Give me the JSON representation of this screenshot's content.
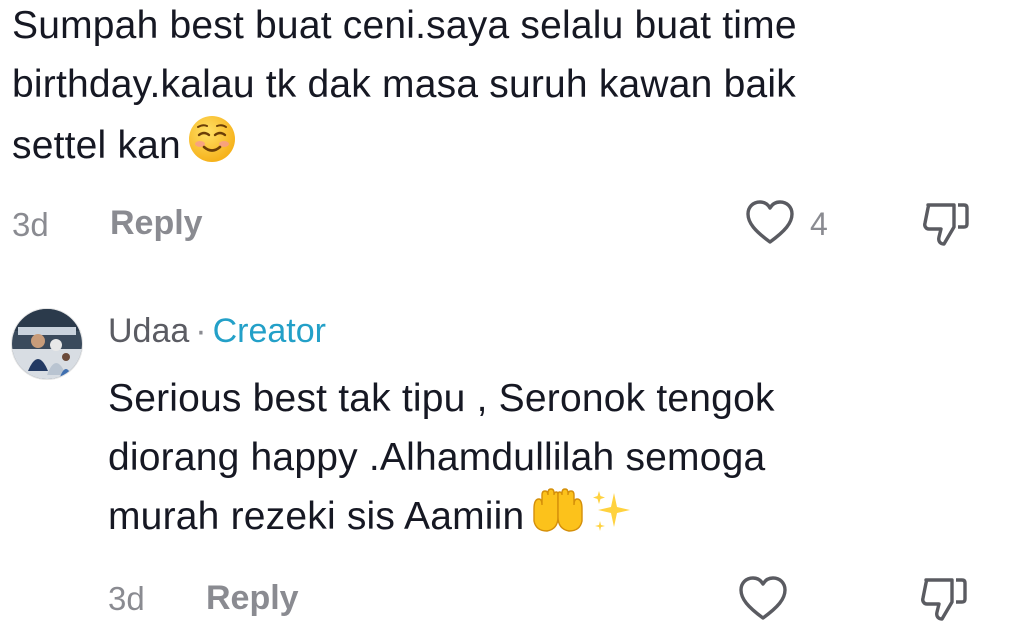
{
  "main_comment": {
    "lines": [
      "Sumpah best buat ceni.saya selalu buat time",
      "birthday.kalau tk dak masa suruh kawan baik",
      "settel kan"
    ],
    "emoji": "smiling-face-emoji",
    "time": "3d",
    "reply_label": "Reply",
    "like_count": "4"
  },
  "reply_comment": {
    "author": "Udaa",
    "separator": "·",
    "badge": "Creator",
    "lines": [
      "Serious best tak tipu , Seronok tengok",
      "diorang happy .Alhamdullilah semoga",
      "murah rezeki sis Aamiin"
    ],
    "emojis": [
      "palms-up-together-emoji",
      "sparkles-emoji"
    ],
    "time": "3d",
    "reply_label": "Reply"
  },
  "colors": {
    "text": "#161823",
    "muted": "#8a8b91",
    "creator": "#23a0c8"
  }
}
